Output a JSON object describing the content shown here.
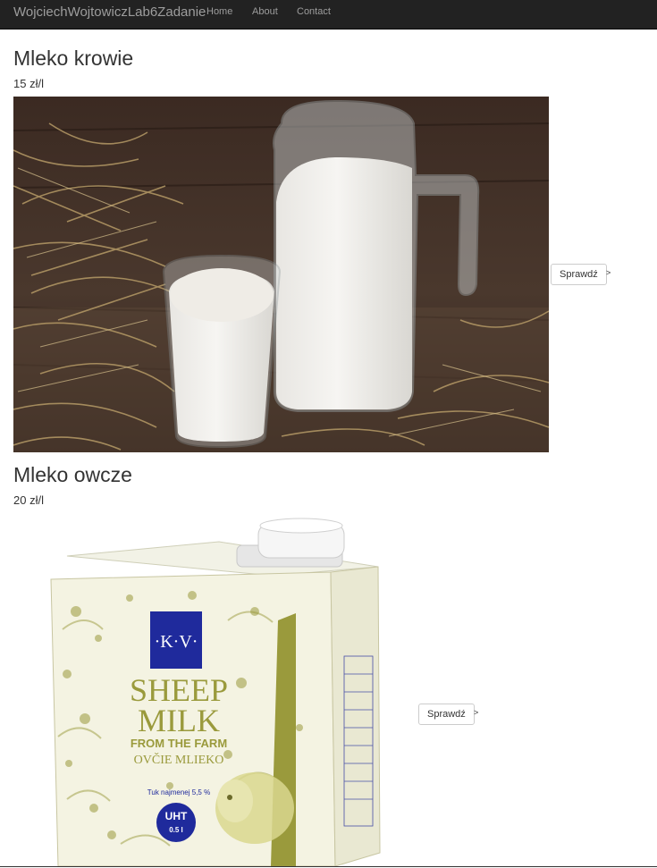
{
  "navbar": {
    "brand": "WojciechWojtowiczLab6Zadanie",
    "links": [
      "Home",
      "About",
      "Contact"
    ]
  },
  "products": [
    {
      "name": "Mleko krowie",
      "price": "15 zł/l",
      "button": "Sprawdź",
      "arrow": ">"
    },
    {
      "name": "Mleko owcze",
      "price": "20 zł/l",
      "button": "Sprawdź",
      "arrow": ">"
    }
  ],
  "packaging": {
    "brand_mark": "·K·V·",
    "line1": "SHEEP",
    "line2": "MILK",
    "line3": "FROM THE FARM",
    "line4": "OVČIE MLIEKO",
    "fat": "Tuk najmenej 5,5 %",
    "uht": "UHT",
    "volume": "0.5 l"
  },
  "colors": {
    "navbar": "#222222",
    "nav_text": "#9d9d9d",
    "pack_olive": "#9a9a3c",
    "pack_blue": "#1f2a9c"
  }
}
